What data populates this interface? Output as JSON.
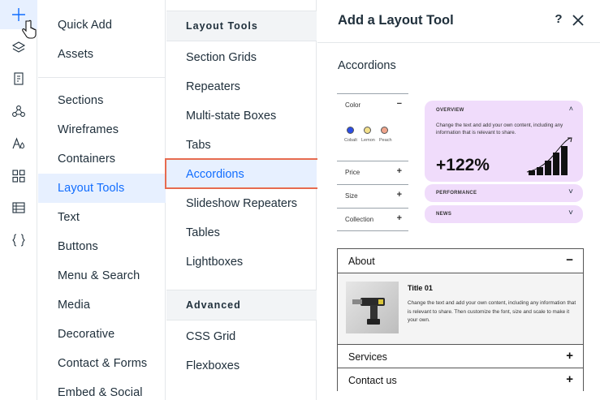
{
  "rail": {
    "icons": [
      "add-icon",
      "layers-icon",
      "page-icon",
      "nodes-icon",
      "typography-icon",
      "apps-icon",
      "table-icon",
      "code-braces-icon"
    ]
  },
  "categories": {
    "items": [
      "Quick Add",
      "Assets",
      "Sections",
      "Wireframes",
      "Containers",
      "Layout Tools",
      "Text",
      "Buttons",
      "Menu & Search",
      "Media",
      "Decorative",
      "Contact & Forms",
      "Embed & Social"
    ],
    "selected": "Layout Tools"
  },
  "tools": {
    "section1": "Layout Tools",
    "items1": [
      "Section Grids",
      "Repeaters",
      "Multi-state Boxes",
      "Tabs",
      "Accordions",
      "Slideshow Repeaters",
      "Tables",
      "Lightboxes"
    ],
    "section2": "Advanced",
    "items2": [
      "CSS Grid",
      "Flexboxes"
    ],
    "selected": "Accordions"
  },
  "panel": {
    "title": "Add a Layout Tool",
    "help": "?",
    "subtitle": "Accordions",
    "preview1": {
      "left_rows": [
        "Color",
        "Price",
        "Size",
        "Collection"
      ],
      "left_signs": [
        "−",
        "+",
        "+",
        "+"
      ],
      "swatches": [
        {
          "label": "Cobalt",
          "color": "#2b4de6"
        },
        {
          "label": "Lemon",
          "color": "#f3e08a"
        },
        {
          "label": "Peach",
          "color": "#f0a58c"
        }
      ],
      "card_header": "OVERVIEW",
      "card_body": "Change the text and add your own content, including any information that is relevant to share.",
      "card_stat": "+122%",
      "small_cards": [
        "PERFORMANCE",
        "NEWS"
      ],
      "card_color": "#f0dcfb"
    },
    "preview2": {
      "rows": [
        "About",
        "Services",
        "Contact us"
      ],
      "row_signs": [
        "−",
        "+",
        "+"
      ],
      "body_title": "Title 01",
      "body_text": "Change the text and add your own content, including any information that is relevant to share. Then customize the font, size and scale to make it your own."
    }
  },
  "colors": {
    "accent": "#116dff",
    "selected_bg": "#e7f0ff",
    "highlight": "#e76b4f"
  }
}
